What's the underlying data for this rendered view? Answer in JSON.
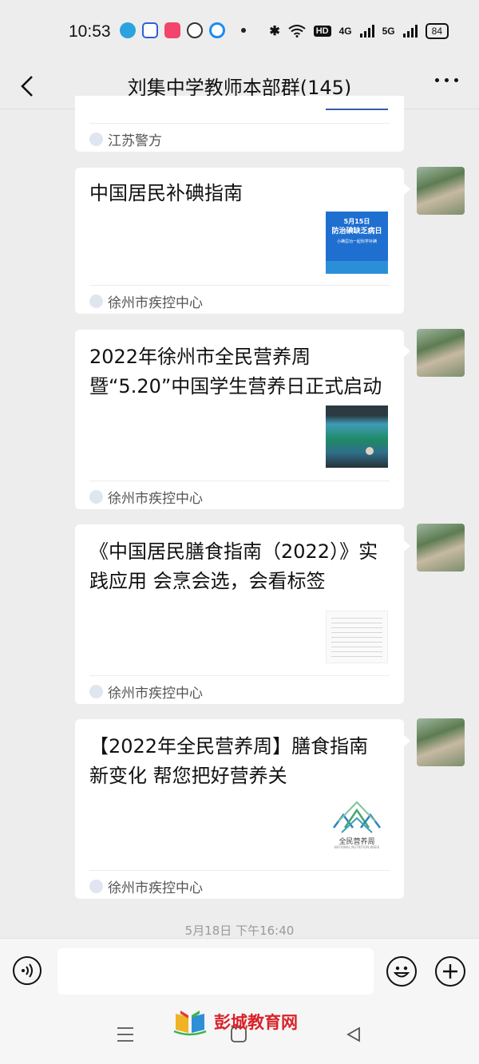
{
  "status_bar": {
    "time": "10:53",
    "battery": "84",
    "hd_label": "HD",
    "net1": "4G",
    "net2": "5G"
  },
  "header": {
    "title": "刘集中学教师本部群(145)"
  },
  "messages": [
    {
      "source": "江苏警方"
    },
    {
      "headline": "中国居民补碘指南",
      "source": "徐州市疾控中心",
      "thumb_lines": [
        "5月15日",
        "防治碘缺乏病日",
        "小碘忍功一起科学补碘"
      ]
    },
    {
      "headline": "2022年徐州市全民营养周暨“5.20”中国学生营养日正式启动",
      "source": "徐州市疾控中心"
    },
    {
      "headline": "《中国居民膳食指南（2022）》实践应用  会烹会选，会看标签",
      "source": "徐州市疾控中心"
    },
    {
      "headline": "【2022年全民营养周】膳食指南新变化 帮您把好营养关",
      "source": "徐州市疾控中心",
      "logo_text": "全民营养周",
      "logo_subtext": "NATIONAL NUTRITION WEEK"
    }
  ],
  "timestamp": "5月18日 下午16:40",
  "watermark": "彭城教育网",
  "colors": {
    "background": "#ededed",
    "card": "#ffffff",
    "thumb_blue": "#1f6fd1",
    "watermark_red": "#d8232a"
  }
}
